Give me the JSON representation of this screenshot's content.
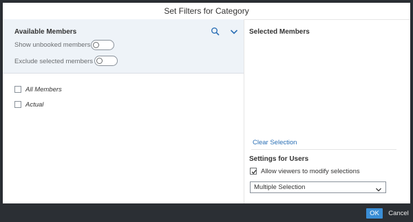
{
  "dialog": {
    "title": "Set Filters for Category"
  },
  "available": {
    "title": "Available Members",
    "options": [
      {
        "label": "Show unbooked members",
        "on": false
      },
      {
        "label": "Exclude selected members",
        "on": false
      }
    ],
    "members": [
      {
        "label": "All Members",
        "checked": false
      },
      {
        "label": "Actual",
        "checked": false
      }
    ]
  },
  "selected": {
    "title": "Selected Members",
    "clear_label": "Clear Selection"
  },
  "settings": {
    "title": "Settings for Users",
    "allow_label": "Allow viewers to modify selections",
    "allow_checked": true,
    "selection_mode": "Multiple Selection"
  },
  "footer": {
    "ok_label": "OK",
    "cancel_label": "Cancel"
  },
  "colors": {
    "accent": "#3a8ed6",
    "link": "#2a6fb5",
    "pane_bg": "#eef3f8",
    "footer_bg": "#2b2f34"
  }
}
